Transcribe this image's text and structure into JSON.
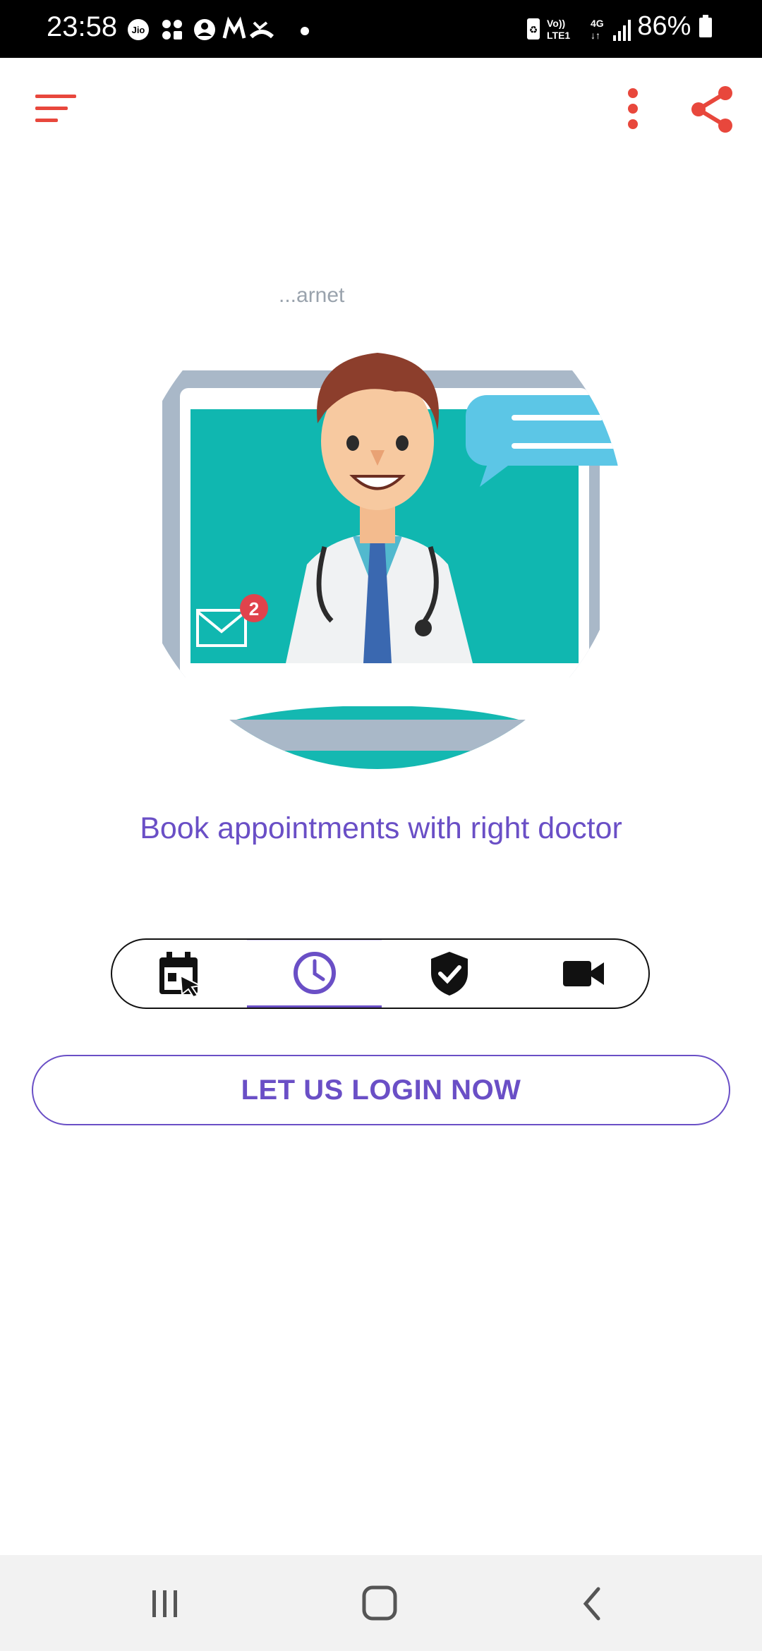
{
  "status_bar": {
    "time": "23:58",
    "battery_percent": "86%",
    "left_icons": [
      "jio-icon",
      "apps-icon",
      "account-icon",
      "gmail-icon",
      "missed-call-icon",
      "dot-icon"
    ],
    "right_icons": [
      "battery-saver-icon",
      "volte-icon",
      "4g-icon",
      "signal-icon",
      "battery-icon"
    ]
  },
  "toolbar": {
    "icons": [
      "sort-icon",
      "more-vert-icon",
      "share-icon"
    ],
    "accent": "#e8473c"
  },
  "hero": {
    "tagline": "Book appointments with right doctor",
    "image_text": "...arnet"
  },
  "features": {
    "items": [
      {
        "icon": "calendar-click-icon",
        "active": false
      },
      {
        "icon": "clock-icon",
        "active": true
      },
      {
        "icon": "shield-check-icon",
        "active": false
      },
      {
        "icon": "video-camera-icon",
        "active": false
      }
    ],
    "accent": "#6a4fc6"
  },
  "login": {
    "label": "LET US LOGIN NOW"
  },
  "nav_bar": {
    "icons": [
      "recents-icon",
      "home-icon",
      "back-icon"
    ]
  }
}
